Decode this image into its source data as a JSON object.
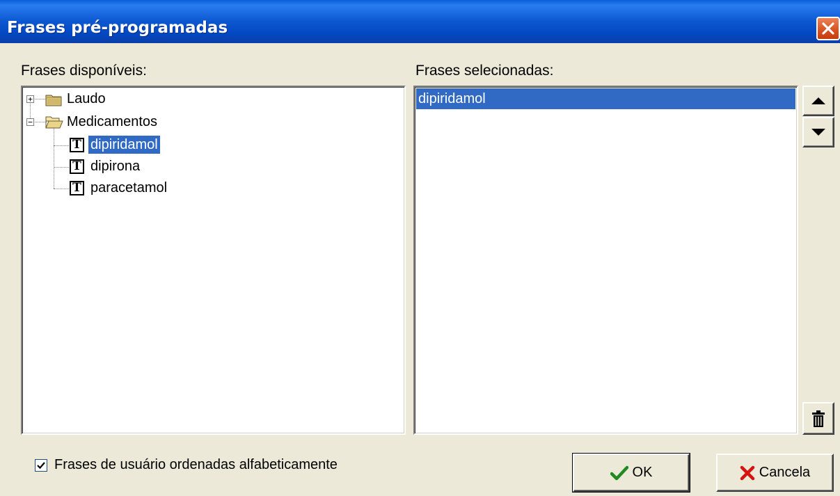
{
  "window": {
    "title": "Frases pré-programadas"
  },
  "left_panel": {
    "label": "Frases disponíveis:",
    "tree": [
      {
        "label": "Laudo",
        "type": "folder",
        "expanded": false
      },
      {
        "label": "Medicamentos",
        "type": "folder",
        "expanded": true,
        "children": [
          {
            "label": "dipiridamol",
            "type": "text",
            "selected": true
          },
          {
            "label": "dipirona",
            "type": "text",
            "selected": false
          },
          {
            "label": "paracetamol",
            "type": "text",
            "selected": false
          }
        ]
      }
    ]
  },
  "right_panel": {
    "label": "Frases selecionadas:",
    "items": [
      {
        "label": "dipiridamol",
        "selected": true
      }
    ]
  },
  "options": {
    "sort_checkbox_label": "Frases de usuário ordenadas alfabeticamente",
    "sort_checked": true
  },
  "buttons": {
    "ok_label": "OK",
    "cancel_label": "Cancela"
  },
  "icons": {
    "text_glyph": "T",
    "expand_glyph": "+",
    "collapse_glyph": "−"
  },
  "colors": {
    "selection": "#316ac5",
    "titlebar": "#0b57d0",
    "close": "#d9501f",
    "dialog_bg": "#ece9d8"
  }
}
